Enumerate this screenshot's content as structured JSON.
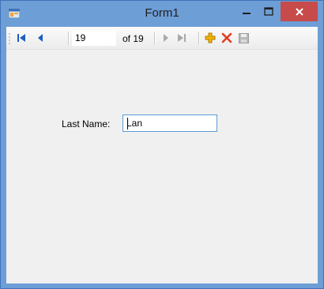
{
  "window": {
    "title": "Form1"
  },
  "titlebar_buttons": {
    "minimize": "minimize",
    "maximize": "maximize",
    "close": "close"
  },
  "navigator": {
    "position_value": "19",
    "count_label": "of 19",
    "buttons": [
      "move-first",
      "move-previous",
      "move-next",
      "move-last",
      "add-new",
      "delete",
      "save"
    ]
  },
  "form": {
    "last_name_label": "Last Name:",
    "last_name_value": "Lan"
  },
  "colors": {
    "titlebar": "#6d9ed6",
    "close_button": "#c74b4b",
    "client": "#f0f0f0",
    "nav_blue": "#1f5fbf",
    "add_yellow": "#f0b400",
    "delete_red": "#e03c1f",
    "input_border": "#5b9bd5"
  }
}
